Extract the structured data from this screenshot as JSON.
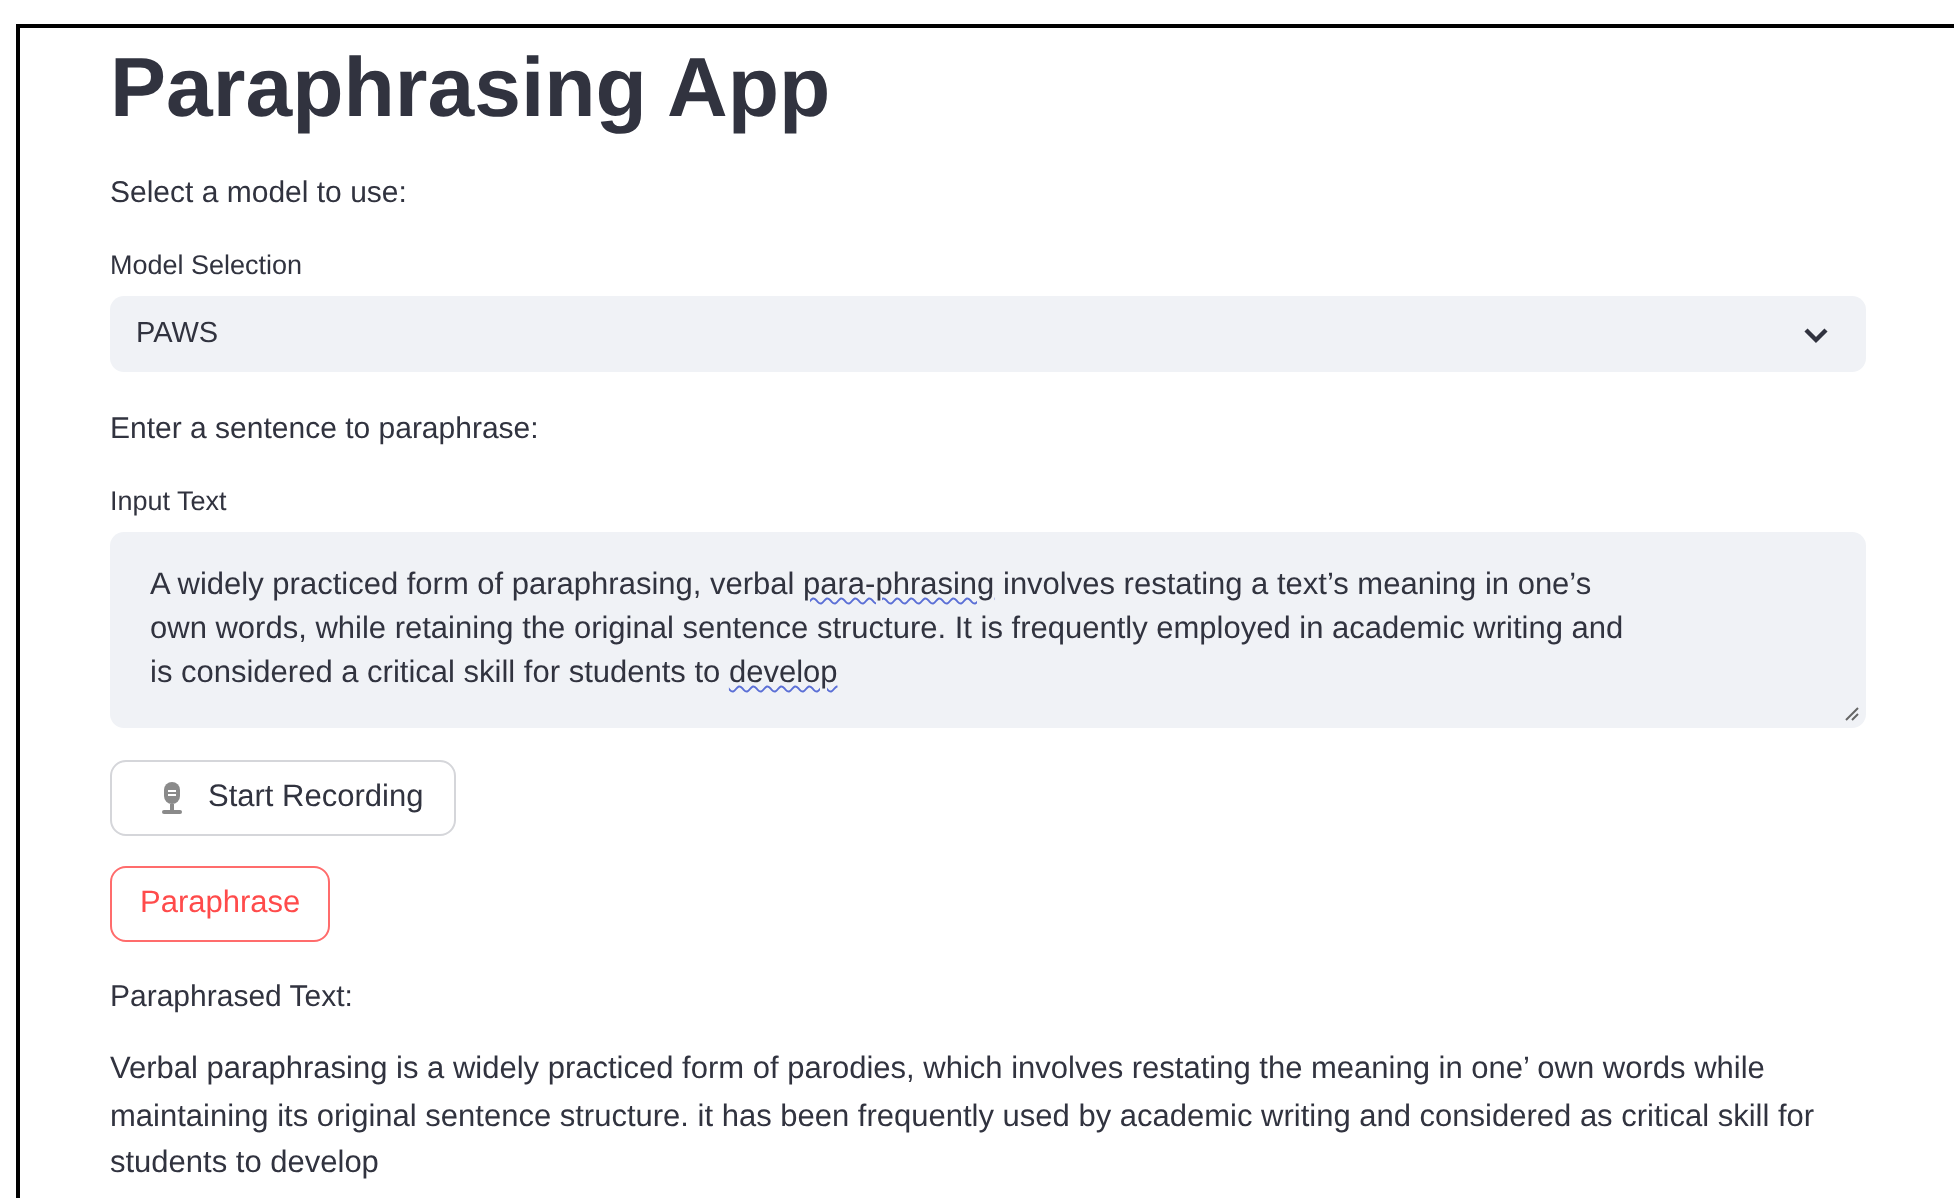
{
  "title": "Paraphrasing App",
  "model_prompt": "Select a model to use:",
  "model_select": {
    "label": "Model Selection",
    "value": "PAWS"
  },
  "input_prompt": "Enter a sentence to paraphrase:",
  "input_text": {
    "label": "Input Text",
    "segments": [
      {
        "text": "A widely practiced form of paraphrasing, verbal ",
        "flagged": false
      },
      {
        "text": "para-phrasing",
        "flagged": true
      },
      {
        "text": " involves restating a text’s meaning in one’s own words, while retaining the original sentence structure. It is frequently employed in academic writing and is considered a critical skill for students to ",
        "flagged": false
      },
      {
        "text": "develop",
        "flagged": true
      }
    ]
  },
  "record_button": "Start Recording",
  "paraphrase_button": "Paraphrase",
  "output_label": "Paraphrased Text:",
  "output_text": "Verbal paraphrasing is a widely practiced form of parodies, which involves restating the meaning in one’ own words while maintaining its original sentence structure. it has been frequently used by academic writing and considered as critical skill for students to develop"
}
